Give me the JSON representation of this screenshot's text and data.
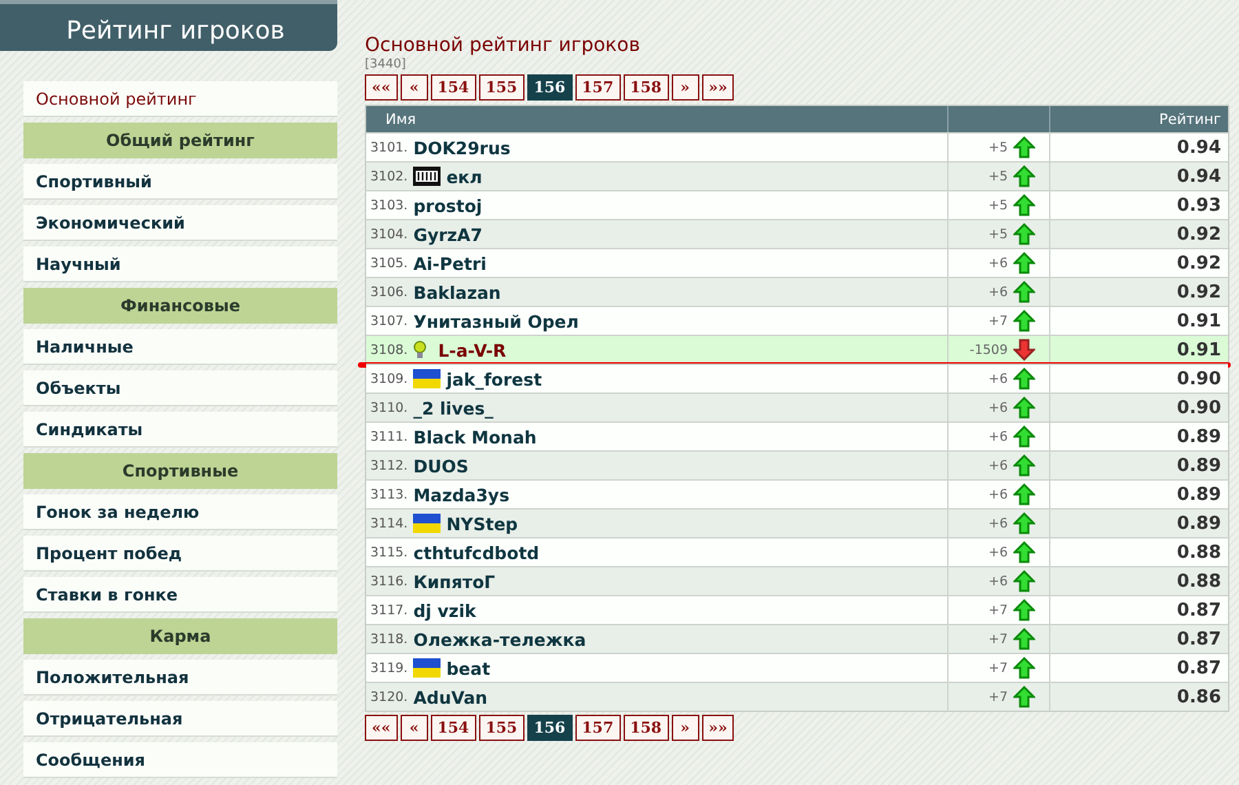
{
  "sidebar": {
    "title": "Рейтинг игроков",
    "items": [
      {
        "kind": "link",
        "label": "Основной рейтинг",
        "selected": true
      },
      {
        "kind": "header",
        "label": "Общий рейтинг"
      },
      {
        "kind": "link",
        "label": "Спортивный",
        "selected": false
      },
      {
        "kind": "link",
        "label": "Экономический",
        "selected": false
      },
      {
        "kind": "link",
        "label": "Научный",
        "selected": false
      },
      {
        "kind": "header",
        "label": "Финансовые"
      },
      {
        "kind": "link",
        "label": "Наличные",
        "selected": false
      },
      {
        "kind": "link",
        "label": "Объекты",
        "selected": false
      },
      {
        "kind": "link",
        "label": "Синдикаты",
        "selected": false
      },
      {
        "kind": "header",
        "label": "Спортивные"
      },
      {
        "kind": "link",
        "label": "Гонок за неделю",
        "selected": false
      },
      {
        "kind": "link",
        "label": "Процент побед",
        "selected": false
      },
      {
        "kind": "link",
        "label": "Ставки в гонке",
        "selected": false
      },
      {
        "kind": "header",
        "label": "Карма"
      },
      {
        "kind": "link",
        "label": "Положительная",
        "selected": false
      },
      {
        "kind": "link",
        "label": "Отрицательная",
        "selected": false
      },
      {
        "kind": "link",
        "label": "Сообщения",
        "selected": false
      }
    ]
  },
  "main": {
    "title": "Основной рейтинг игроков",
    "count": "[3440]",
    "pager": [
      {
        "label": "««",
        "selected": false
      },
      {
        "label": "«",
        "selected": false
      },
      {
        "label": "154",
        "selected": false
      },
      {
        "label": "155",
        "selected": false
      },
      {
        "label": "156",
        "selected": true
      },
      {
        "label": "157",
        "selected": false
      },
      {
        "label": "158",
        "selected": false
      },
      {
        "label": "»",
        "selected": false
      },
      {
        "label": "»»",
        "selected": false
      }
    ],
    "table": {
      "columns": [
        "Имя",
        "Рейтинг"
      ],
      "rows": [
        {
          "rank": "3101.",
          "kind": "plain",
          "name": "DOK29rus",
          "change": "+5",
          "rising": true,
          "rating": "0.94",
          "selected": false,
          "underlined": false
        },
        {
          "rank": "3102.",
          "kind": "badge",
          "name": "екл",
          "change": "+5",
          "rising": true,
          "rating": "0.94",
          "selected": false,
          "underlined": false
        },
        {
          "rank": "3103.",
          "kind": "plain",
          "name": "prostoj",
          "change": "+5",
          "rising": true,
          "rating": "0.93",
          "selected": false,
          "underlined": false
        },
        {
          "rank": "3104.",
          "kind": "plain",
          "name": "GyrzA7",
          "change": "+5",
          "rising": true,
          "rating": "0.92",
          "selected": false,
          "underlined": false
        },
        {
          "rank": "3105.",
          "kind": "plain",
          "name": "Ai-Petri",
          "change": "+6",
          "rising": true,
          "rating": "0.92",
          "selected": false,
          "underlined": false
        },
        {
          "rank": "3106.",
          "kind": "plain",
          "name": "Baklazan",
          "change": "+6",
          "rising": true,
          "rating": "0.92",
          "selected": false,
          "underlined": false
        },
        {
          "rank": "3107.",
          "kind": "plain",
          "name": "Унитазный Орел",
          "change": "+7",
          "rising": true,
          "rating": "0.91",
          "selected": false,
          "underlined": false
        },
        {
          "rank": "3108.",
          "kind": "bulb",
          "name": "L-a-V-R",
          "change": "-1509",
          "rising": false,
          "rating": "0.91",
          "selected": true,
          "underlined": true
        },
        {
          "rank": "3109.",
          "kind": "flag",
          "name": "jak_forest",
          "change": "+6",
          "rising": true,
          "rating": "0.90",
          "selected": false,
          "underlined": false
        },
        {
          "rank": "3110.",
          "kind": "plain",
          "name": "_2 lives_",
          "change": "+6",
          "rising": true,
          "rating": "0.90",
          "selected": false,
          "underlined": false
        },
        {
          "rank": "3111.",
          "kind": "plain",
          "name": "Black Monah",
          "change": "+6",
          "rising": true,
          "rating": "0.89",
          "selected": false,
          "underlined": false
        },
        {
          "rank": "3112.",
          "kind": "plain",
          "name": "DUOS",
          "change": "+6",
          "rising": true,
          "rating": "0.89",
          "selected": false,
          "underlined": false
        },
        {
          "rank": "3113.",
          "kind": "plain",
          "name": "Mazda3ys",
          "change": "+6",
          "rising": true,
          "rating": "0.89",
          "selected": false,
          "underlined": false
        },
        {
          "rank": "3114.",
          "kind": "flag",
          "name": "NYStep",
          "change": "+6",
          "rising": true,
          "rating": "0.89",
          "selected": false,
          "underlined": false
        },
        {
          "rank": "3115.",
          "kind": "plain",
          "name": "cthtufcdbotd",
          "change": "+6",
          "rising": true,
          "rating": "0.88",
          "selected": false,
          "underlined": false
        },
        {
          "rank": "3116.",
          "kind": "plain",
          "name": "КипятоГ",
          "change": "+6",
          "rising": true,
          "rating": "0.88",
          "selected": false,
          "underlined": false
        },
        {
          "rank": "3117.",
          "kind": "plain",
          "name": "dj vzik",
          "change": "+7",
          "rising": true,
          "rating": "0.87",
          "selected": false,
          "underlined": false
        },
        {
          "rank": "3118.",
          "kind": "plain",
          "name": "Олежка-тележка",
          "change": "+7",
          "rising": true,
          "rating": "0.87",
          "selected": false,
          "underlined": false
        },
        {
          "rank": "3119.",
          "kind": "flag",
          "name": "beat",
          "change": "+7",
          "rising": true,
          "rating": "0.87",
          "selected": false,
          "underlined": false
        },
        {
          "rank": "3120.",
          "kind": "plain",
          "name": "AduVan",
          "change": "+7",
          "rising": true,
          "rating": "0.86",
          "selected": false,
          "underlined": false
        }
      ]
    },
    "pager_bottom": [
      {
        "label": "««",
        "selected": false
      },
      {
        "label": "«",
        "selected": false
      },
      {
        "label": "154",
        "selected": false
      },
      {
        "label": "155",
        "selected": false
      },
      {
        "label": "156",
        "selected": true
      },
      {
        "label": "157",
        "selected": false
      },
      {
        "label": "158",
        "selected": false
      },
      {
        "label": "»",
        "selected": false
      },
      {
        "label": "»»",
        "selected": false
      }
    ]
  }
}
